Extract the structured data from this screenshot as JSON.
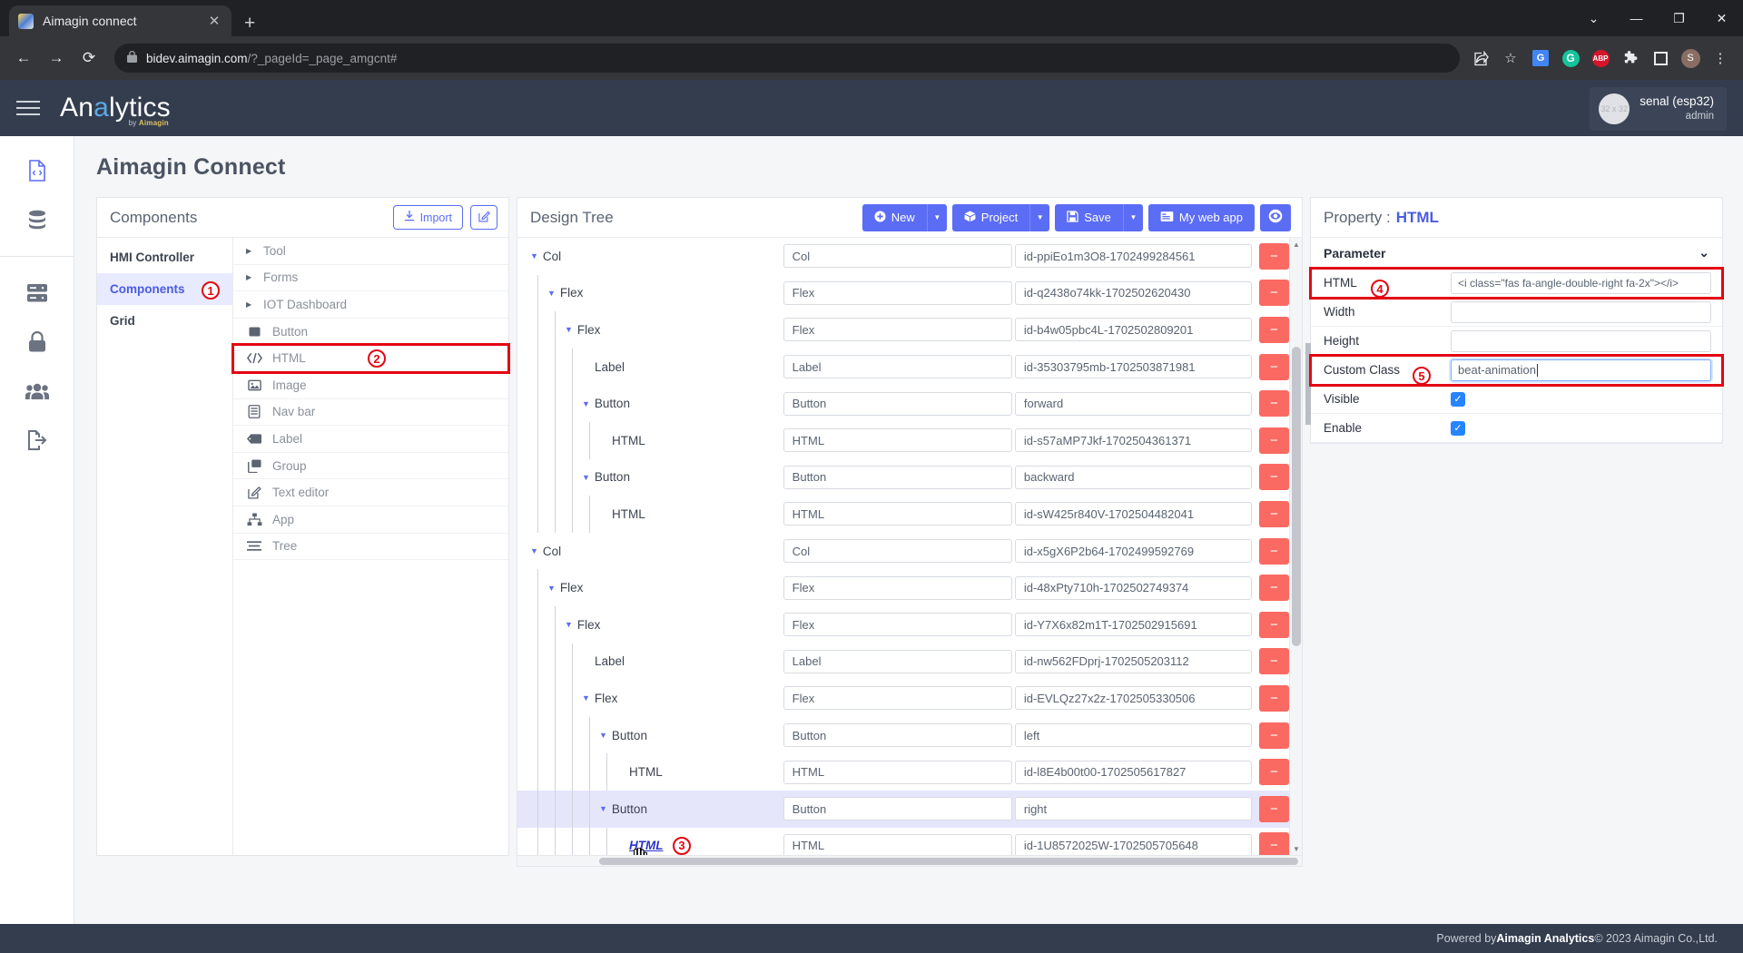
{
  "browser": {
    "tab_title": "Aimagin connect",
    "tab_close": "✕",
    "new_tab": "+",
    "win_minimize": "—",
    "win_maximize": "❐",
    "win_close": "✕",
    "win_dropdown": "⌄",
    "back": "←",
    "forward": "→",
    "reload": "⟳",
    "lock": "🔒",
    "url_host": "bidev.aimagin.com",
    "url_path": "/?_pageId=_page_amgcnt#",
    "toolbar_icons": [
      "share-icon",
      "bookmark-star-icon",
      "google-translate-icon",
      "grammarly-icon",
      "adblock-plus-icon",
      "extensions-icon",
      "sidepanel-icon",
      "profile-avatar",
      "chrome-menu-icon"
    ],
    "translate_glyph": "G",
    "grammarly_glyph": "G",
    "abp_glyph": "ABP",
    "profile_glyph": "S",
    "menu_glyph": "⋮",
    "share_glyph": "⇪",
    "star_glyph": "☆",
    "puzzle_glyph": "🧩"
  },
  "header": {
    "brand_pre": "An",
    "brand_hl": "a",
    "brand_post": "lytics",
    "brand_sub_by": "by",
    "brand_sub_name": "Aimagin",
    "user_avatar_text": "32 x 32",
    "user_name": "senal (esp32)",
    "user_role": "admin"
  },
  "rail": {
    "items": [
      {
        "name": "file-code-icon",
        "active": true
      },
      {
        "name": "database-icon",
        "active": false
      },
      {
        "name": "server-icon",
        "active": false
      },
      {
        "name": "lock-icon",
        "active": false
      },
      {
        "name": "users-icon",
        "active": false
      },
      {
        "name": "logout-icon",
        "active": false
      }
    ]
  },
  "page": {
    "title": "Aimagin Connect"
  },
  "components": {
    "title": "Components",
    "import_label": "Import",
    "edit_icon": "✎",
    "categories": [
      {
        "label": "HMI Controller",
        "active": false,
        "badge": ""
      },
      {
        "label": "Components",
        "active": true,
        "badge": "1"
      },
      {
        "label": "Grid",
        "active": false,
        "badge": ""
      }
    ],
    "items": [
      {
        "label": "Tool",
        "expandable": true,
        "icon": "",
        "highlight": false,
        "badge": ""
      },
      {
        "label": "Forms",
        "expandable": true,
        "icon": "",
        "highlight": false,
        "badge": ""
      },
      {
        "label": "IOT Dashboard",
        "expandable": true,
        "icon": "",
        "highlight": false,
        "badge": ""
      },
      {
        "label": "Button",
        "expandable": false,
        "icon": "button-icon",
        "highlight": false,
        "badge": ""
      },
      {
        "label": "HTML",
        "expandable": false,
        "icon": "code-icon",
        "highlight": true,
        "badge": "2"
      },
      {
        "label": "Image",
        "expandable": false,
        "icon": "image-icon",
        "highlight": false,
        "badge": ""
      },
      {
        "label": "Nav bar",
        "expandable": false,
        "icon": "navbar-icon",
        "highlight": false,
        "badge": ""
      },
      {
        "label": "Label",
        "expandable": false,
        "icon": "label-icon",
        "highlight": false,
        "badge": ""
      },
      {
        "label": "Group",
        "expandable": false,
        "icon": "group-icon",
        "highlight": false,
        "badge": ""
      },
      {
        "label": "Text editor",
        "expandable": false,
        "icon": "text-editor-icon",
        "highlight": false,
        "badge": ""
      },
      {
        "label": "App",
        "expandable": false,
        "icon": "app-icon",
        "highlight": false,
        "badge": ""
      },
      {
        "label": "Tree",
        "expandable": false,
        "icon": "tree-icon",
        "highlight": false,
        "badge": ""
      }
    ]
  },
  "design_tree": {
    "title": "Design Tree",
    "buttons": {
      "new": "New",
      "project": "Project",
      "save": "Save",
      "my_web_app": "My web app",
      "preview_icon": "👁"
    },
    "rows": [
      {
        "label": "Col",
        "depth": 0,
        "expander": true,
        "type": "Col",
        "id": "id-ppiEo1m3O8-1702499284561",
        "selected": false,
        "active_node": false
      },
      {
        "label": "Flex",
        "depth": 1,
        "expander": true,
        "type": "Flex",
        "id": "id-q2438o74kk-1702502620430",
        "selected": false,
        "active_node": false
      },
      {
        "label": "Flex",
        "depth": 2,
        "expander": true,
        "type": "Flex",
        "id": "id-b4w05pbc4L-1702502809201",
        "selected": false,
        "active_node": false
      },
      {
        "label": "Label",
        "depth": 3,
        "expander": false,
        "type": "Label",
        "id": "id-35303795mb-1702503871981",
        "selected": false,
        "active_node": false
      },
      {
        "label": "Button",
        "depth": 3,
        "expander": true,
        "type": "Button",
        "id": "forward",
        "selected": false,
        "active_node": false
      },
      {
        "label": "HTML",
        "depth": 4,
        "expander": false,
        "type": "HTML",
        "id": "id-s57aMP7Jkf-1702504361371",
        "selected": false,
        "active_node": false
      },
      {
        "label": "Button",
        "depth": 3,
        "expander": true,
        "type": "Button",
        "id": "backward",
        "selected": false,
        "active_node": false
      },
      {
        "label": "HTML",
        "depth": 4,
        "expander": false,
        "type": "HTML",
        "id": "id-sW425r840V-1702504482041",
        "selected": false,
        "active_node": false
      },
      {
        "label": "Col",
        "depth": 0,
        "expander": true,
        "type": "Col",
        "id": "id-x5gX6P2b64-1702499592769",
        "selected": false,
        "active_node": false
      },
      {
        "label": "Flex",
        "depth": 1,
        "expander": true,
        "type": "Flex",
        "id": "id-48xPty710h-1702502749374",
        "selected": false,
        "active_node": false
      },
      {
        "label": "Flex",
        "depth": 2,
        "expander": true,
        "type": "Flex",
        "id": "id-Y7X6x82m1T-1702502915691",
        "selected": false,
        "active_node": false
      },
      {
        "label": "Label",
        "depth": 3,
        "expander": false,
        "type": "Label",
        "id": "id-nw562FDprj-1702505203112",
        "selected": false,
        "active_node": false
      },
      {
        "label": "Flex",
        "depth": 3,
        "expander": true,
        "type": "Flex",
        "id": "id-EVLQz27x2z-1702505330506",
        "selected": false,
        "active_node": false
      },
      {
        "label": "Button",
        "depth": 4,
        "expander": true,
        "type": "Button",
        "id": "left",
        "selected": false,
        "active_node": false
      },
      {
        "label": "HTML",
        "depth": 5,
        "expander": false,
        "type": "HTML",
        "id": "id-l8E4b00t00-1702505617827",
        "selected": false,
        "active_node": false
      },
      {
        "label": "Button",
        "depth": 4,
        "expander": true,
        "type": "Button",
        "id": "right",
        "selected": true,
        "active_node": false
      },
      {
        "label": "HTML",
        "depth": 5,
        "expander": false,
        "type": "HTML",
        "id": "id-1U8572025W-1702505705648",
        "selected": false,
        "active_node": true,
        "badge": "3"
      }
    ]
  },
  "property": {
    "title": "Property :",
    "target": "HTML",
    "section": "Parameter",
    "collapse_icon": "⌄",
    "rows": [
      {
        "label": "HTML",
        "value": "<i class=\"fas fa-angle-double-right fa-2x\"></i>",
        "kind": "text",
        "highlight": true,
        "badge": "4",
        "focused": false
      },
      {
        "label": "Width",
        "value": "",
        "kind": "text",
        "highlight": false,
        "badge": "",
        "focused": false
      },
      {
        "label": "Height",
        "value": "",
        "kind": "text",
        "highlight": false,
        "badge": "",
        "focused": false
      },
      {
        "label": "Custom Class",
        "value": "beat-animation",
        "kind": "text",
        "highlight": true,
        "badge": "5",
        "focused": true
      },
      {
        "label": "Visible",
        "value": "checked",
        "kind": "check",
        "highlight": false,
        "badge": "",
        "focused": false
      },
      {
        "label": "Enable",
        "value": "checked",
        "kind": "check",
        "highlight": false,
        "badge": "",
        "focused": false
      }
    ]
  },
  "footer": {
    "powered_pre": "Powered by ",
    "brand": "Aimagin Analytics",
    "copyright": " © 2023 Aimagin Co.,Ltd."
  }
}
